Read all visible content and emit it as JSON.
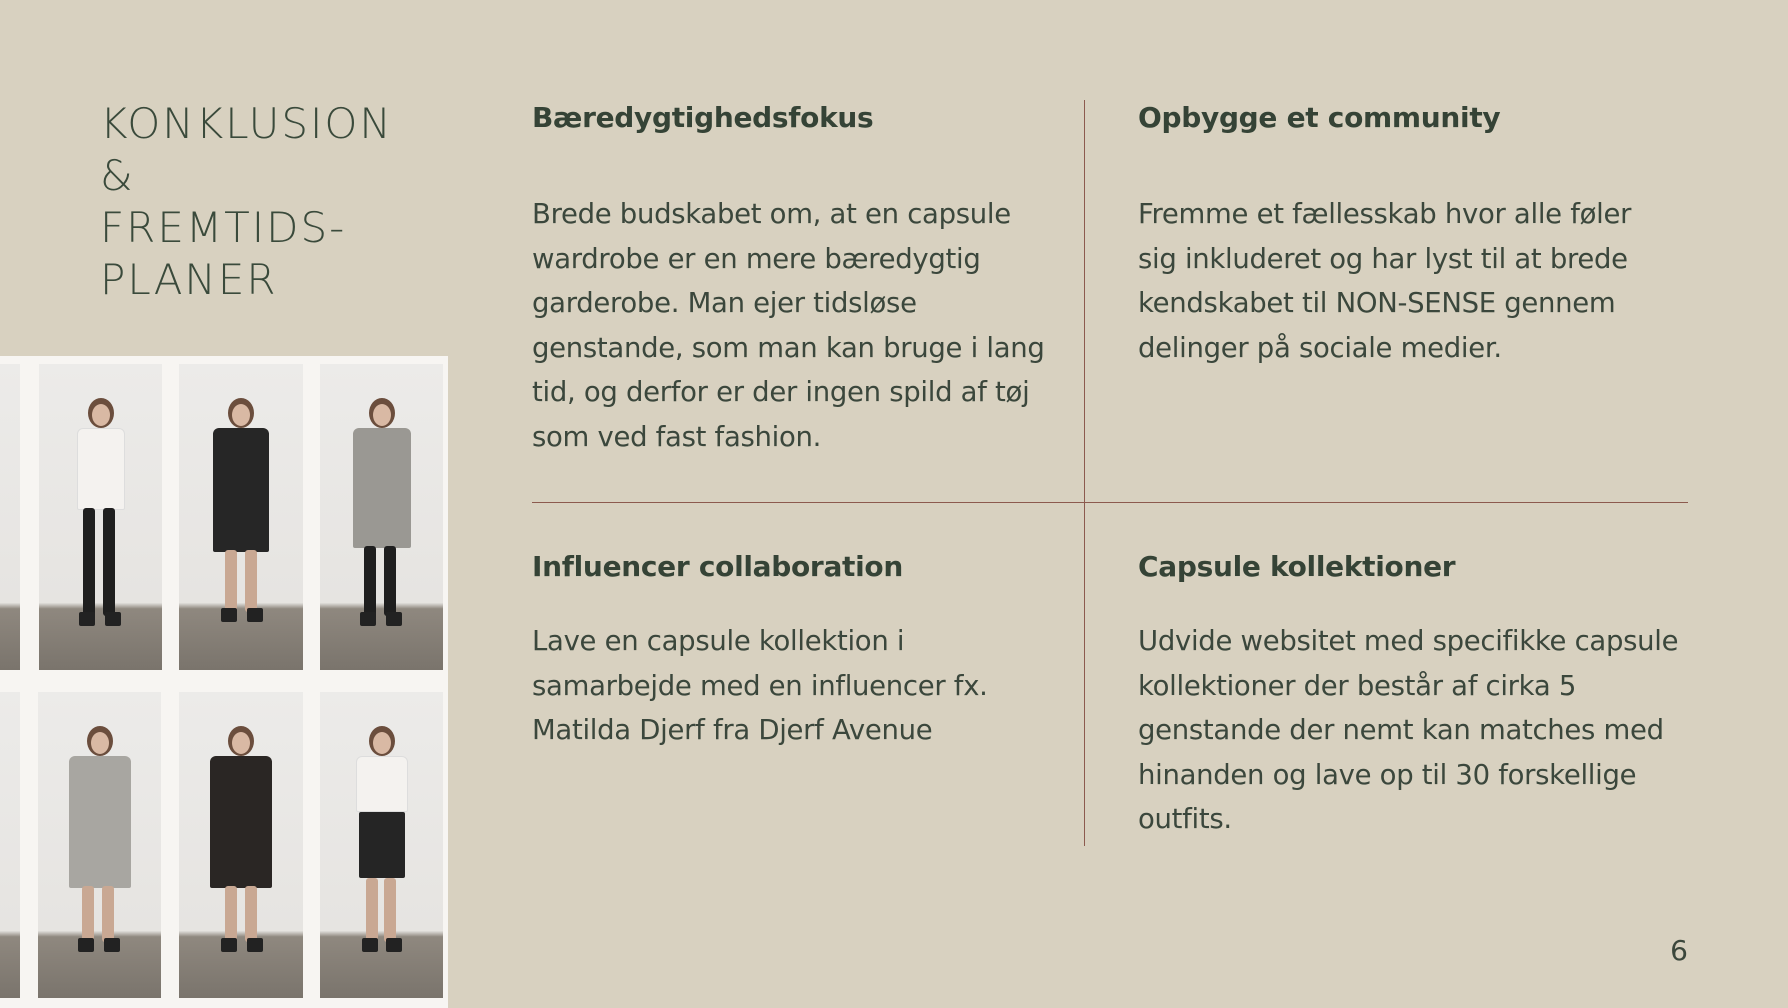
{
  "slide": {
    "title_lines": [
      "KONKLUSION",
      "&",
      "FREMTIDS-",
      "PLANER"
    ],
    "sections": [
      {
        "heading": "Bæredygtighedsfokus",
        "body": "Brede budskabet om, at en capsule wardrobe er en mere bæredygtig garderobe. Man ejer tidsløse genstande, som man kan bruge i lang tid, og derfor er der ingen spild af tøj som ved fast fashion."
      },
      {
        "heading": "Opbygge et community",
        "body": "Fremme et fællesskab hvor alle føler sig inkluderet og har lyst til at brede kendskabet til NON-SENSE gennem delinger på sociale medier."
      },
      {
        "heading": "Influencer collaboration",
        "body": "Lave en capsule kollektion i samarbejde med en influencer fx. Matilda Djerf  fra Djerf Avenue"
      },
      {
        "heading": "Capsule kollektioner",
        "body": "Udvide websitet med specifikke capsule kollektioner der består af cirka 5 genstande der nemt kan matches med hinanden og lave op til 30 forskellige outfits."
      }
    ],
    "page_number": "6"
  },
  "colors": {
    "background": "#d8d1c0",
    "text": "#354336",
    "divider": "#8c5a4e"
  }
}
